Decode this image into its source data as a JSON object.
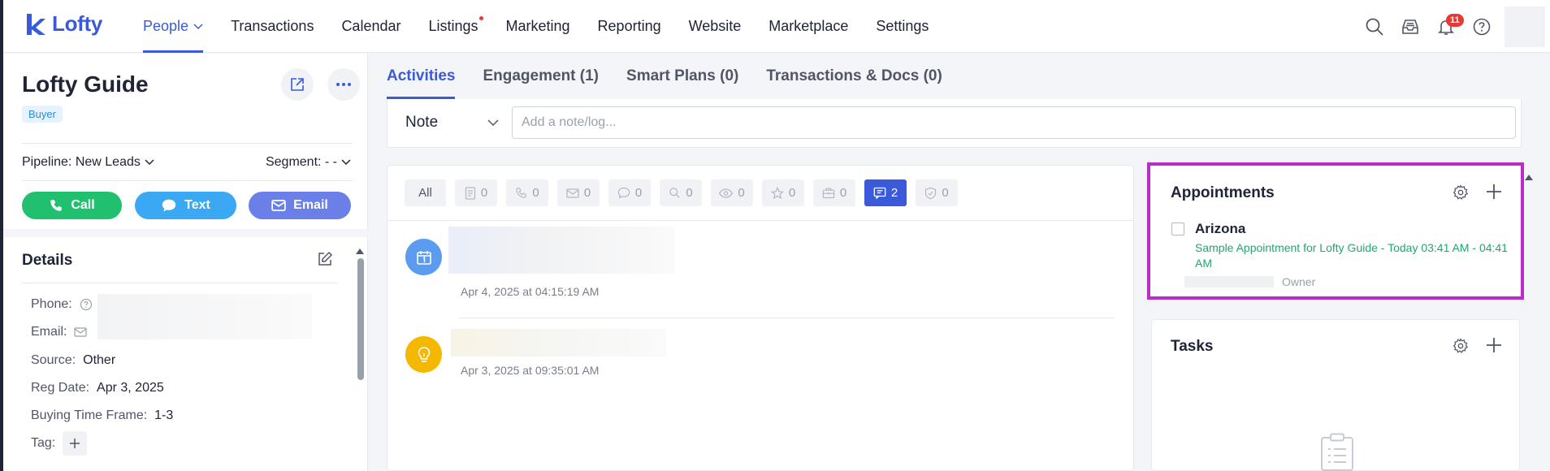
{
  "app": {
    "brand": "Lofty",
    "accent": "#3a5ad9"
  },
  "nav": {
    "items": [
      {
        "label": "People",
        "active": true,
        "has_dropdown": true
      },
      {
        "label": "Transactions"
      },
      {
        "label": "Calendar"
      },
      {
        "label": "Listings",
        "dot": true
      },
      {
        "label": "Marketing"
      },
      {
        "label": "Reporting"
      },
      {
        "label": "Website"
      },
      {
        "label": "Marketplace"
      },
      {
        "label": "Settings"
      }
    ],
    "notification_count": "11",
    "icons": [
      "search-icon",
      "inbox-icon",
      "bell-icon",
      "help-icon"
    ]
  },
  "contact": {
    "name": "Lofty Guide",
    "badge": "Buyer",
    "pipeline": "Pipeline: New Leads",
    "segment": "Segment: - -",
    "actions": {
      "call": "Call",
      "text": "Text",
      "email": "Email"
    },
    "action_colors": {
      "call": "#20c06f",
      "text": "#3aa8f3",
      "email": "#6a7fe8"
    }
  },
  "details": {
    "title": "Details",
    "phone_label": "Phone:",
    "email_label": "Email:",
    "source_label": "Source:",
    "source_value": "Other",
    "reg_date_label": "Reg Date:",
    "reg_date_value": "Apr 3, 2025",
    "time_frame_label": "Buying Time Frame:",
    "time_frame_value": "1-3",
    "tag_label": "Tag:"
  },
  "tabs": [
    {
      "label": "Activities",
      "active": true
    },
    {
      "label": "Engagement (1)"
    },
    {
      "label": "Smart Plans (0)"
    },
    {
      "label": "Transactions & Docs (0)"
    }
  ],
  "note": {
    "type": "Note",
    "placeholder": "Add a note/log..."
  },
  "filters": {
    "all": "All",
    "chips": [
      {
        "icon": "note-icon",
        "count": "0"
      },
      {
        "icon": "phone-icon",
        "count": "0"
      },
      {
        "icon": "mail-icon",
        "count": "0"
      },
      {
        "icon": "chat-icon",
        "count": "0"
      },
      {
        "icon": "search-icon",
        "count": "0"
      },
      {
        "icon": "eye-icon",
        "count": "0"
      },
      {
        "icon": "star-icon",
        "count": "0"
      },
      {
        "icon": "briefcase-icon",
        "count": "0"
      },
      {
        "icon": "message-icon",
        "count": "2",
        "active": true
      },
      {
        "icon": "shield-check-icon",
        "count": "0"
      }
    ]
  },
  "timeline": [
    {
      "icon": "calendar-icon",
      "color": "#5b9cf1",
      "time": "Apr 4, 2025 at 04:15:19 AM"
    },
    {
      "icon": "lightbulb-icon",
      "color": "#f5b800",
      "time": "Apr 3, 2025 at 09:35:01 AM"
    }
  ],
  "appointments": {
    "title": "Appointments",
    "item_name": "Arizona",
    "item_desc": "Sample Appointment for Lofty Guide - Today 03:41 AM - 04:41 AM",
    "owner_label": "Owner",
    "highlight_color": "#b82ec7"
  },
  "tasks": {
    "title": "Tasks"
  }
}
